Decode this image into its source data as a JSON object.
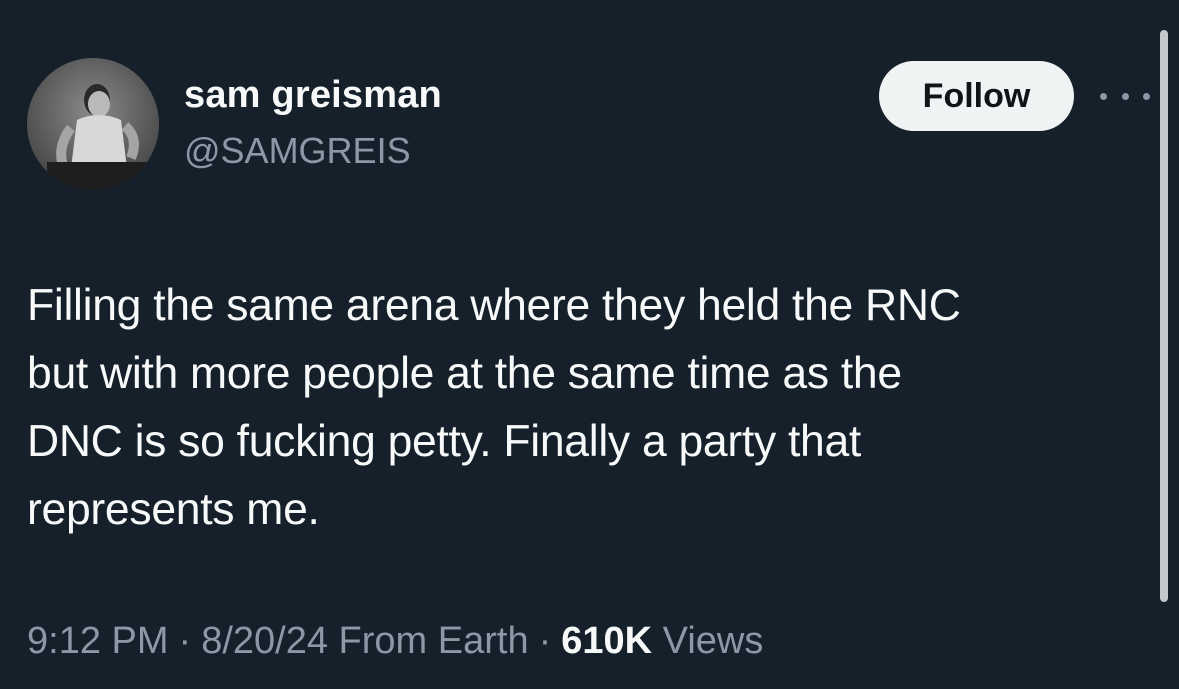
{
  "author": {
    "display_name": "sam greisman",
    "handle": "@SAMGREIS",
    "avatar_icon": "profile-photo"
  },
  "actions": {
    "follow_label": "Follow",
    "more_icon": "more-dots-icon"
  },
  "tweet": {
    "lines": [
      "Filling the same arena where they held the RNC",
      "but with more people at the same time as the",
      "DNC is so fucking petty. Finally a party that",
      "represents me."
    ]
  },
  "meta": {
    "time": "9:12 PM",
    "date": "8/20/24",
    "source": "From Earth",
    "separator": "·",
    "views_count": "610K",
    "views_label": "Views"
  },
  "colors": {
    "background": "#15202b",
    "primary_text": "#f7f9f9",
    "secondary_text": "#8b98a5",
    "follow_button_bg": "#eff3f4"
  }
}
